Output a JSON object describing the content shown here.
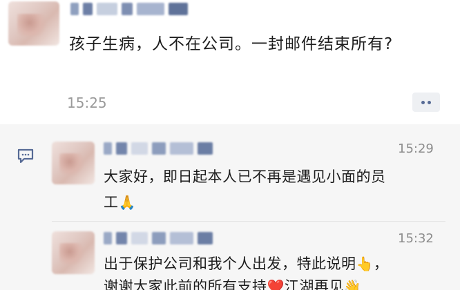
{
  "post": {
    "text": "孩子生病，人不在公司。一封邮件结束所有?",
    "time": "15:25",
    "more_icon": "more-dots-icon"
  },
  "comments": [
    {
      "time": "15:29",
      "text_line1": "大家好，即日起本人已不再是遇见小面的员",
      "text_line2": "工",
      "emoji": "🙏"
    },
    {
      "time": "15:32",
      "text_line1": "出于保护公司和我个人出发，特此说明",
      "emoji1": "👆",
      "text_line1_end": "，",
      "text_line2": "谢谢大家此前的所有支持",
      "emoji2": "❤️",
      "text_line2_end": "江湖再见",
      "emoji3": "👋"
    }
  ],
  "colors": {
    "page_bg": "#ffffff",
    "comments_bg": "#f6f6f6",
    "link_blue": "#566a95",
    "time_gray": "#9a9a9a"
  }
}
